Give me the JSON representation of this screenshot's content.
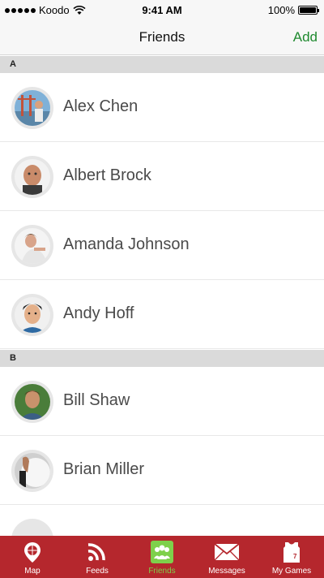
{
  "status_bar": {
    "carrier": "Koodo",
    "time": "9:41 AM",
    "battery": "100%"
  },
  "nav": {
    "title": "Friends",
    "add_label": "Add"
  },
  "sections": [
    {
      "letter": "A",
      "friends": [
        "Alex Chen",
        "Albert Brock",
        "Amanda Johnson",
        "Andy Hoff"
      ]
    },
    {
      "letter": "B",
      "friends": [
        "Bill Shaw",
        "Brian Miller"
      ]
    }
  ],
  "tabs": [
    {
      "label": "Map",
      "icon": "map-pin-icon"
    },
    {
      "label": "Feeds",
      "icon": "rss-icon"
    },
    {
      "label": "Friends",
      "icon": "friends-icon",
      "active": true
    },
    {
      "label": "Messages",
      "icon": "envelope-icon"
    },
    {
      "label": "My Games",
      "icon": "jersey-icon"
    }
  ],
  "colors": {
    "accent_green": "#1f8a2f",
    "tab_bar": "#b5272d",
    "active_tab": "#7ed04b"
  }
}
